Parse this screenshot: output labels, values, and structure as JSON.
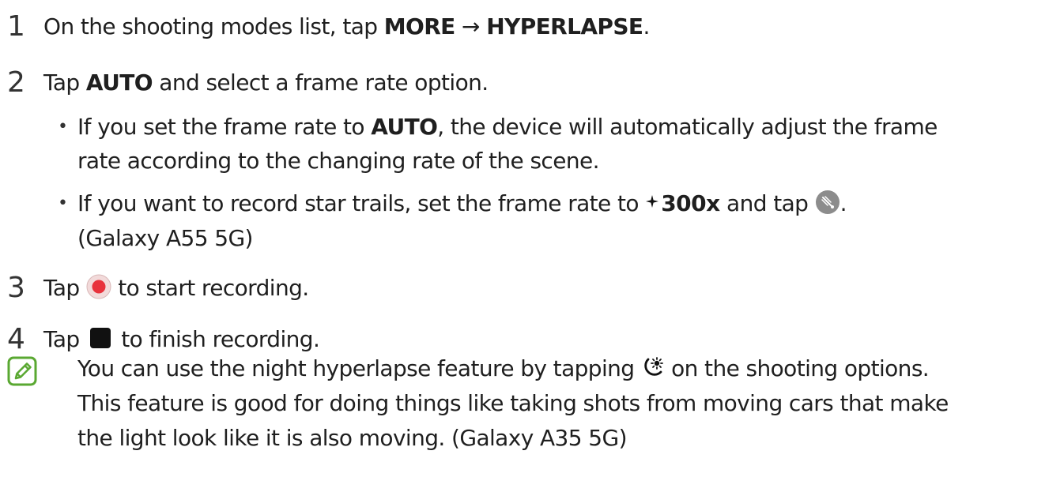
{
  "steps": {
    "s1": {
      "num": "1",
      "pre": "On the shooting modes list, tap ",
      "more": "MORE",
      "arrow": " → ",
      "hyper": "HYPERLAPSE",
      "post": "."
    },
    "s2": {
      "num": "2",
      "pre": "Tap ",
      "auto": "AUTO",
      "post": " and select a frame rate option."
    },
    "b1": {
      "bullet": "•",
      "l1_pre": "If you set the frame rate to ",
      "l1_auto": "AUTO",
      "l1_post": ", the device will automatically adjust the frame",
      "l2": "rate according to the changing rate of the scene."
    },
    "b2": {
      "bullet": "•",
      "l1_pre": "If you want to record star trails, set the frame rate to ",
      "rate": "300",
      "rate_x": "x",
      "l1_mid": " and tap ",
      "l1_post": ".",
      "l2": "(Galaxy A55 5G)"
    },
    "s3": {
      "num": "3",
      "pre": "Tap ",
      "post": " to start recording."
    },
    "s4": {
      "num": "4",
      "pre": "Tap ",
      "post": " to finish recording."
    }
  },
  "note": {
    "l1_pre": "You can use the night hyperlapse feature by tapping ",
    "l1_post": " on the shooting options.",
    "l2": "This feature is good for doing things like taking shots from moving cars that make",
    "l3": "the light look like it is also moving. (Galaxy A35 5G)"
  },
  "icons": {
    "note": "note-pencil-icon",
    "star_trail": "star-trail-icon",
    "record": "record-icon",
    "stop": "stop-icon",
    "night_hyperlapse": "night-hyperlapse-icon",
    "sparkle": "sparkle-icon"
  },
  "colors": {
    "text": "#1f1f1f",
    "record_red": "#e8323c",
    "note_green": "#5aa832"
  }
}
